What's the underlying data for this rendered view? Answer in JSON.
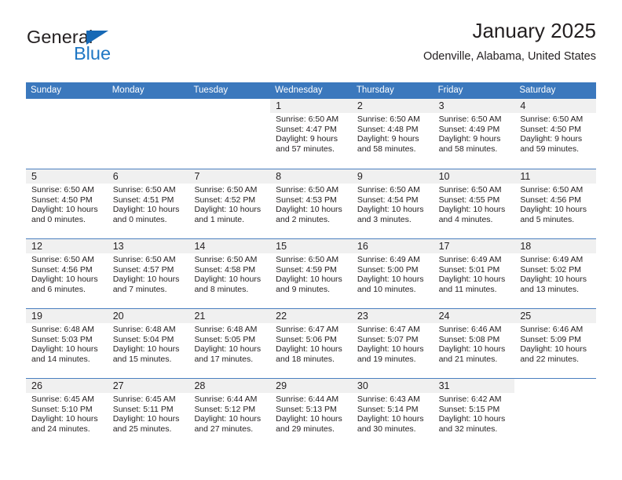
{
  "brand": {
    "name_top": "General",
    "name_bottom": "Blue",
    "accent_color": "#1f77c4",
    "triangle_color": "#1769b5"
  },
  "header": {
    "title": "January 2025",
    "subtitle": "Odenville, Alabama, United States",
    "header_bg_color": "#3b78bd",
    "daynum_band_color": "#f0f0f0"
  },
  "calendar": {
    "weekday_headers": [
      "Sunday",
      "Monday",
      "Tuesday",
      "Wednesday",
      "Thursday",
      "Friday",
      "Saturday"
    ],
    "weeks": [
      [
        {
          "empty": true
        },
        {
          "empty": true
        },
        {
          "empty": true
        },
        {
          "day": "1",
          "sunrise": "Sunrise: 6:50 AM",
          "sunset": "Sunset: 4:47 PM",
          "daylight1": "Daylight: 9 hours",
          "daylight2": "and 57 minutes."
        },
        {
          "day": "2",
          "sunrise": "Sunrise: 6:50 AM",
          "sunset": "Sunset: 4:48 PM",
          "daylight1": "Daylight: 9 hours",
          "daylight2": "and 58 minutes."
        },
        {
          "day": "3",
          "sunrise": "Sunrise: 6:50 AM",
          "sunset": "Sunset: 4:49 PM",
          "daylight1": "Daylight: 9 hours",
          "daylight2": "and 58 minutes."
        },
        {
          "day": "4",
          "sunrise": "Sunrise: 6:50 AM",
          "sunset": "Sunset: 4:50 PM",
          "daylight1": "Daylight: 9 hours",
          "daylight2": "and 59 minutes."
        }
      ],
      [
        {
          "day": "5",
          "sunrise": "Sunrise: 6:50 AM",
          "sunset": "Sunset: 4:50 PM",
          "daylight1": "Daylight: 10 hours",
          "daylight2": "and 0 minutes."
        },
        {
          "day": "6",
          "sunrise": "Sunrise: 6:50 AM",
          "sunset": "Sunset: 4:51 PM",
          "daylight1": "Daylight: 10 hours",
          "daylight2": "and 0 minutes."
        },
        {
          "day": "7",
          "sunrise": "Sunrise: 6:50 AM",
          "sunset": "Sunset: 4:52 PM",
          "daylight1": "Daylight: 10 hours",
          "daylight2": "and 1 minute."
        },
        {
          "day": "8",
          "sunrise": "Sunrise: 6:50 AM",
          "sunset": "Sunset: 4:53 PM",
          "daylight1": "Daylight: 10 hours",
          "daylight2": "and 2 minutes."
        },
        {
          "day": "9",
          "sunrise": "Sunrise: 6:50 AM",
          "sunset": "Sunset: 4:54 PM",
          "daylight1": "Daylight: 10 hours",
          "daylight2": "and 3 minutes."
        },
        {
          "day": "10",
          "sunrise": "Sunrise: 6:50 AM",
          "sunset": "Sunset: 4:55 PM",
          "daylight1": "Daylight: 10 hours",
          "daylight2": "and 4 minutes."
        },
        {
          "day": "11",
          "sunrise": "Sunrise: 6:50 AM",
          "sunset": "Sunset: 4:56 PM",
          "daylight1": "Daylight: 10 hours",
          "daylight2": "and 5 minutes."
        }
      ],
      [
        {
          "day": "12",
          "sunrise": "Sunrise: 6:50 AM",
          "sunset": "Sunset: 4:56 PM",
          "daylight1": "Daylight: 10 hours",
          "daylight2": "and 6 minutes."
        },
        {
          "day": "13",
          "sunrise": "Sunrise: 6:50 AM",
          "sunset": "Sunset: 4:57 PM",
          "daylight1": "Daylight: 10 hours",
          "daylight2": "and 7 minutes."
        },
        {
          "day": "14",
          "sunrise": "Sunrise: 6:50 AM",
          "sunset": "Sunset: 4:58 PM",
          "daylight1": "Daylight: 10 hours",
          "daylight2": "and 8 minutes."
        },
        {
          "day": "15",
          "sunrise": "Sunrise: 6:50 AM",
          "sunset": "Sunset: 4:59 PM",
          "daylight1": "Daylight: 10 hours",
          "daylight2": "and 9 minutes."
        },
        {
          "day": "16",
          "sunrise": "Sunrise: 6:49 AM",
          "sunset": "Sunset: 5:00 PM",
          "daylight1": "Daylight: 10 hours",
          "daylight2": "and 10 minutes."
        },
        {
          "day": "17",
          "sunrise": "Sunrise: 6:49 AM",
          "sunset": "Sunset: 5:01 PM",
          "daylight1": "Daylight: 10 hours",
          "daylight2": "and 11 minutes."
        },
        {
          "day": "18",
          "sunrise": "Sunrise: 6:49 AM",
          "sunset": "Sunset: 5:02 PM",
          "daylight1": "Daylight: 10 hours",
          "daylight2": "and 13 minutes."
        }
      ],
      [
        {
          "day": "19",
          "sunrise": "Sunrise: 6:48 AM",
          "sunset": "Sunset: 5:03 PM",
          "daylight1": "Daylight: 10 hours",
          "daylight2": "and 14 minutes."
        },
        {
          "day": "20",
          "sunrise": "Sunrise: 6:48 AM",
          "sunset": "Sunset: 5:04 PM",
          "daylight1": "Daylight: 10 hours",
          "daylight2": "and 15 minutes."
        },
        {
          "day": "21",
          "sunrise": "Sunrise: 6:48 AM",
          "sunset": "Sunset: 5:05 PM",
          "daylight1": "Daylight: 10 hours",
          "daylight2": "and 17 minutes."
        },
        {
          "day": "22",
          "sunrise": "Sunrise: 6:47 AM",
          "sunset": "Sunset: 5:06 PM",
          "daylight1": "Daylight: 10 hours",
          "daylight2": "and 18 minutes."
        },
        {
          "day": "23",
          "sunrise": "Sunrise: 6:47 AM",
          "sunset": "Sunset: 5:07 PM",
          "daylight1": "Daylight: 10 hours",
          "daylight2": "and 19 minutes."
        },
        {
          "day": "24",
          "sunrise": "Sunrise: 6:46 AM",
          "sunset": "Sunset: 5:08 PM",
          "daylight1": "Daylight: 10 hours",
          "daylight2": "and 21 minutes."
        },
        {
          "day": "25",
          "sunrise": "Sunrise: 6:46 AM",
          "sunset": "Sunset: 5:09 PM",
          "daylight1": "Daylight: 10 hours",
          "daylight2": "and 22 minutes."
        }
      ],
      [
        {
          "day": "26",
          "sunrise": "Sunrise: 6:45 AM",
          "sunset": "Sunset: 5:10 PM",
          "daylight1": "Daylight: 10 hours",
          "daylight2": "and 24 minutes."
        },
        {
          "day": "27",
          "sunrise": "Sunrise: 6:45 AM",
          "sunset": "Sunset: 5:11 PM",
          "daylight1": "Daylight: 10 hours",
          "daylight2": "and 25 minutes."
        },
        {
          "day": "28",
          "sunrise": "Sunrise: 6:44 AM",
          "sunset": "Sunset: 5:12 PM",
          "daylight1": "Daylight: 10 hours",
          "daylight2": "and 27 minutes."
        },
        {
          "day": "29",
          "sunrise": "Sunrise: 6:44 AM",
          "sunset": "Sunset: 5:13 PM",
          "daylight1": "Daylight: 10 hours",
          "daylight2": "and 29 minutes."
        },
        {
          "day": "30",
          "sunrise": "Sunrise: 6:43 AM",
          "sunset": "Sunset: 5:14 PM",
          "daylight1": "Daylight: 10 hours",
          "daylight2": "and 30 minutes."
        },
        {
          "day": "31",
          "sunrise": "Sunrise: 6:42 AM",
          "sunset": "Sunset: 5:15 PM",
          "daylight1": "Daylight: 10 hours",
          "daylight2": "and 32 minutes."
        },
        {
          "empty": true
        }
      ]
    ]
  }
}
